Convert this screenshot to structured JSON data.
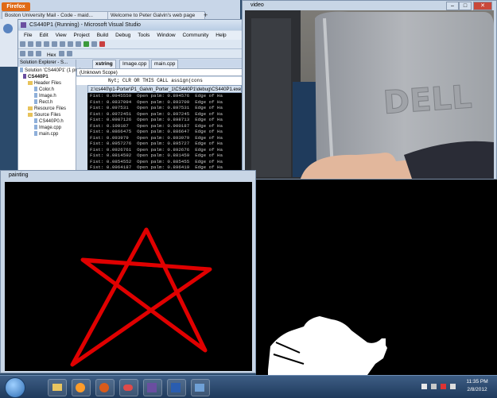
{
  "firefox": {
    "button": "Firefox",
    "tabs": [
      "Boston University Mail - Code - maid...",
      "Welcome to Peter Galvin's web page"
    ],
    "plus": "+"
  },
  "vs": {
    "title": "CS440P1 (Running) - Microsoft Visual Studio",
    "menu": [
      "File",
      "Edit",
      "View",
      "Project",
      "Build",
      "Debug",
      "Tools",
      "Window",
      "Community",
      "Help"
    ],
    "hex_label": "Hex",
    "solution_explorer": {
      "header": "Solution Explorer - S...",
      "items": [
        "Solution 'CS440P1' (1 proje",
        "CS440P1",
        "Header Files",
        "Color.h",
        "Image.h",
        "Rect.h",
        "Resource Files",
        "Source Files",
        "CS440P0.h",
        "Image.cpp",
        "main.cpp"
      ]
    },
    "editor_tabs": [
      "xstring",
      "Image.cpp",
      "main.cpp"
    ],
    "scope": "(Unknown Scope)",
    "code_line": "Nyt;    CLR OR THIS CALL assign(cons"
  },
  "console": {
    "title": "z:\\cs440\\p1-Porter\\P1_Galvin_Porter_1\\CS440P1\\debug\\CS440P1.exe",
    "lines": [
      "Fist: 0.0945559  Open palm: 0.894576  Edge of Ha",
      "Fist: 0.0837094  Open palm: 0.893709  Edge of Ha",
      "Fist: 0.097531   Open palm: 0.897531  Edge of Ha",
      "Fist: 0.0972451  Open palm: 0.897245  Edge of Ha",
      "Fist: 0.0987126  Open palm: 0.898713  Edge of Ha",
      "Fist: 0.100187   Open palm: 0.900187  Edge of Ha",
      "Fist: 0.0866475  Open palm: 0.886647  Edge of Ha",
      "Fist: 0.093979   Open palm: 0.893979  Edge of Ha",
      "Fist: 0.0957276  Open palm: 0.895727  Edge of Ha",
      "Fist: 0.0926761  Open palm: 0.892676  Edge of Ha",
      "Fist: 0.0814592  Open palm: 0.881459  Edge of Ha",
      "Fist: 0.0854552  Open palm: 0.885455  Edge of Ha",
      "Fist: 0.0964187  Open palm: 0.896419  Edge of Ha",
      "Fist: 0.102265   Open palm: 0.902265  Edge of Ha",
      "Fist: 0.0951659  Open palm: 0.895166  Edge of Ha"
    ]
  },
  "video": {
    "title": "video",
    "logo": "DELL"
  },
  "painting": {
    "title": "painting",
    "stroke_color": "#e00000"
  },
  "taskbar": {
    "clock_time": "11:35 PM",
    "clock_date": "2/8/2012"
  }
}
